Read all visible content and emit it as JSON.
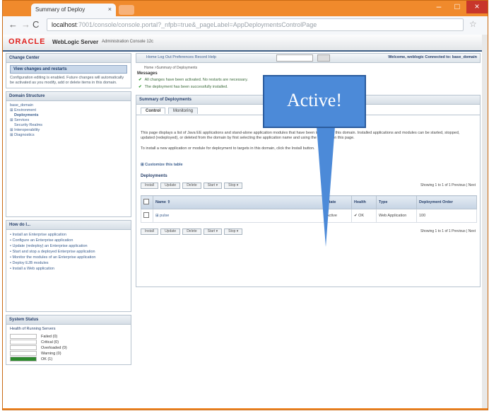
{
  "browser": {
    "tab_title": "Summary of Deploy",
    "tab_close": "×",
    "url_host": "localhost",
    "url_rest": ":7001/console/console.portal?_nfpb=true&_pageLabel=AppDeploymentsControlPage",
    "window_min": "–",
    "window_max": "□",
    "window_close": "×",
    "back": "←",
    "forward": "→",
    "reload": "C",
    "star": "☆"
  },
  "header": {
    "logo": "ORACLE",
    "product": "WebLogic Server",
    "subtitle": "Administration Console 12c"
  },
  "toolbar": {
    "links": "Home  Log Out  Preferences  Record  Help",
    "welcome": "Welcome, weblogic  Connected to: base_domain"
  },
  "change_center": {
    "title": "Change Center",
    "heading": "View changes and restarts",
    "text": "Configuration editing is enabled. Future changes will automatically be activated as you modify, add or delete items in this domain."
  },
  "domain_structure": {
    "title": "Domain Structure",
    "items": [
      "base_domain",
      "⊞ Environment",
      "   Deployments",
      "⊞ Services",
      "   Security Realms",
      "⊞ Interoperability",
      "⊞ Diagnostics"
    ]
  },
  "how_do_i": {
    "title": "How do I...",
    "items": [
      "Install an Enterprise application",
      "Configure an Enterprise application",
      "Update (redeploy) an Enterprise application",
      "Start and stop a deployed Enterprise application",
      "Monitor the modules of an Enterprise application",
      "Deploy EJB modules",
      "Install a Web application"
    ]
  },
  "system_status": {
    "title": "System Status",
    "subtitle": "Health of Running Servers",
    "rows": [
      {
        "label": "Failed (0)",
        "color": "#ffffff"
      },
      {
        "label": "Critical (0)",
        "color": "#ffffff"
      },
      {
        "label": "Overloaded (0)",
        "color": "#ffffff"
      },
      {
        "label": "Warning (0)",
        "color": "#ffffff"
      },
      {
        "label": "OK (1)",
        "color": "#2e8b2e"
      }
    ]
  },
  "main": {
    "breadcrumb": "Home >Summary of Deployments",
    "messages_title": "Messages",
    "messages": [
      "All changes have been activated. No restarts are necessary.",
      "The deployment has been successfully installed."
    ],
    "panel_title": "Summary of Deployments",
    "tabs": [
      "Control",
      "Monitoring"
    ],
    "description": "This page displays a list of Java EE applications and stand-alone application modules that have been installed to this domain. Installed applications and modules can be started, stopped, updated (redeployed), or deleted from the domain by first selecting the application name and using the controls on this page.",
    "install_note": "To install a new application or module for deployment to targets in this domain, click the Install button.",
    "customize": "⊞ Customize this table",
    "deployments_title": "Deployments",
    "buttons": [
      "Install",
      "Update",
      "Delete",
      "Start ▾",
      "Stop ▾"
    ],
    "paging": "Showing 1 to 1 of 1   Previous | Next",
    "columns": [
      "Name ⇧",
      "State",
      "Health",
      "Type",
      "Deployment Order"
    ],
    "rows": [
      {
        "name": "⊞ pulse",
        "state": "Active",
        "health": "✔ OK",
        "type": "Web Application",
        "order": "100"
      }
    ]
  },
  "callout": {
    "text": "Active!"
  }
}
